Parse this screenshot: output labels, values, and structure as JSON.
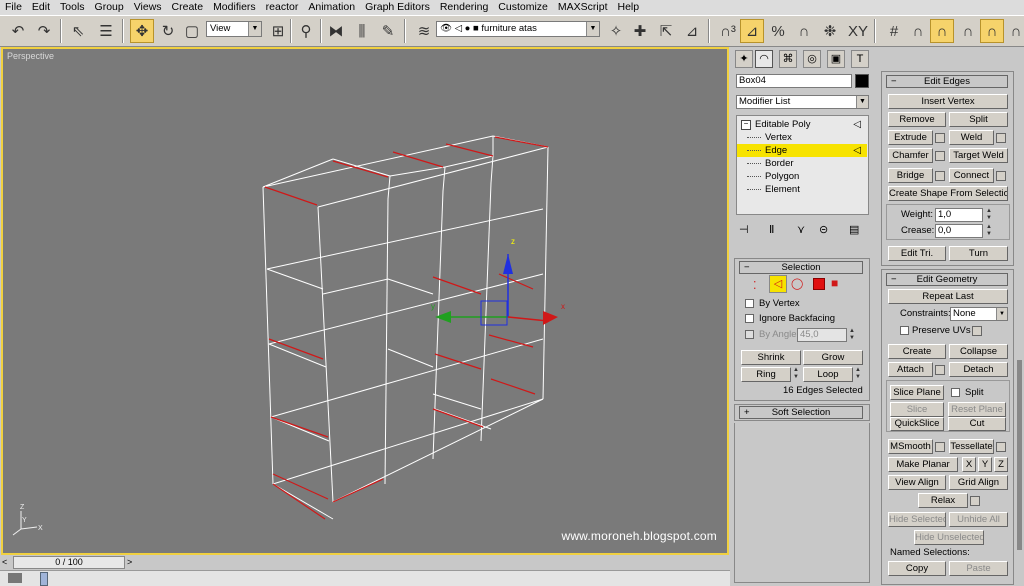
{
  "menu": [
    "File",
    "Edit",
    "Tools",
    "Group",
    "Views",
    "Create",
    "Modifiers",
    "reactor",
    "Animation",
    "Graph Editors",
    "Rendering",
    "Customize",
    "MAXScript",
    "Help"
  ],
  "toolbar": {
    "view_dropdown": "View",
    "layer_dropdown": "furniture atas"
  },
  "viewport": {
    "label": "Perspective",
    "watermark": "www.moroneh.blogspot.com",
    "gizmo_labels": {
      "z": "z",
      "x": "x",
      "y": "y"
    },
    "axis_tripod": {
      "x": "X",
      "y": "Y",
      "z": "Z"
    }
  },
  "timeline": {
    "slider_label": "0 / 100"
  },
  "modify_panel": {
    "object_name": "Box04",
    "object_color": "#000000",
    "modifier_list": "Modifier List",
    "stack": {
      "root": "Editable Poly",
      "items": [
        "Vertex",
        "Edge",
        "Border",
        "Polygon",
        "Element"
      ],
      "selected_index": 1
    },
    "selection": {
      "title": "Selection",
      "by_vertex": "By Vertex",
      "ignore_backfacing": "Ignore Backfacing",
      "by_angle": "By Angle:",
      "by_angle_value": "45,0",
      "shrink": "Shrink",
      "grow": "Grow",
      "ring": "Ring",
      "loop": "Loop",
      "status": "16 Edges Selected"
    },
    "soft_selection": {
      "title": "Soft Selection"
    }
  },
  "edit_edges": {
    "title": "Edit Edges",
    "insert_vertex": "Insert Vertex",
    "remove": "Remove",
    "split": "Split",
    "extrude": "Extrude",
    "weld": "Weld",
    "chamfer": "Chamfer",
    "target_weld": "Target Weld",
    "bridge": "Bridge",
    "connect": "Connect",
    "create_shape": "Create Shape From Selection",
    "weight_label": "Weight:",
    "weight_value": "1,0",
    "crease_label": "Crease:",
    "crease_value": "0,0",
    "edit_tri": "Edit Tri.",
    "turn": "Turn"
  },
  "edit_geometry": {
    "title": "Edit Geometry",
    "repeat_last": "Repeat Last",
    "constraints_label": "Constraints:",
    "constraints_value": "None",
    "preserve_uvs": "Preserve UVs",
    "create": "Create",
    "collapse": "Collapse",
    "attach": "Attach",
    "detach": "Detach",
    "slice_plane": "Slice Plane",
    "split": "Split",
    "slice": "Slice",
    "reset_plane": "Reset Plane",
    "quickslice": "QuickSlice",
    "cut": "Cut",
    "msmooth": "MSmooth",
    "tessellate": "Tessellate",
    "make_planar": "Make Planar",
    "x": "X",
    "y": "Y",
    "z": "Z",
    "view_align": "View Align",
    "grid_align": "Grid Align",
    "relax": "Relax",
    "hide_selected": "Hide Selected",
    "unhide_all": "Unhide All",
    "hide_unselected": "Hide Unselected",
    "named_selections": "Named Selections:",
    "copy": "Copy",
    "paste": "Paste"
  }
}
